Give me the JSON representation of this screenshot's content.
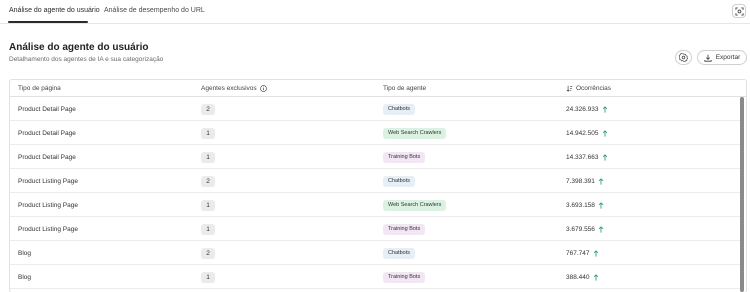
{
  "tabs": [
    {
      "label": "Análise do agente do usuário"
    },
    {
      "label": "Análise de desempenho do URL"
    }
  ],
  "header": {
    "title": "Análise do agente do usuário",
    "subtitle": "Detalhamento dos agentes de IA e sua categorização",
    "export_label": "Exportar"
  },
  "table": {
    "columns": [
      "Tipo de página",
      "Agentes exclusivos",
      "Tipo de agente",
      "Ocorrências"
    ],
    "rows": [
      {
        "page_type": "Product Detail Page",
        "agents": "2",
        "agent_type": "Chatbots",
        "occurrences": "24.326.933"
      },
      {
        "page_type": "Product Detail Page",
        "agents": "1",
        "agent_type": "Web Search Crawlers",
        "occurrences": "14.942.505"
      },
      {
        "page_type": "Product Detail Page",
        "agents": "1",
        "agent_type": "Training Bots",
        "occurrences": "14.337.663"
      },
      {
        "page_type": "Product Listing Page",
        "agents": "2",
        "agent_type": "Chatbots",
        "occurrences": "7.398.391"
      },
      {
        "page_type": "Product Listing Page",
        "agents": "1",
        "agent_type": "Web Search Crawlers",
        "occurrences": "3.693.158"
      },
      {
        "page_type": "Product Listing Page",
        "agents": "1",
        "agent_type": "Training Bots",
        "occurrences": "3.679.556"
      },
      {
        "page_type": "Blog",
        "agents": "2",
        "agent_type": "Chatbots",
        "occurrences": "767.747"
      },
      {
        "page_type": "Blog",
        "agents": "1",
        "agent_type": "Training Bots",
        "occurrences": "388.440"
      }
    ]
  },
  "colors": {
    "trend_up": "#2d9d78",
    "tag_chatbots": "#e6eef6",
    "tag_crawlers": "#dbf2e3",
    "tag_training": "#f2e6f4"
  },
  "icons": {
    "top_right": "focus-icon",
    "info": "info-icon",
    "sort": "sort-icon",
    "settings": "settings-icon",
    "export": "download-icon",
    "trend": "arrow-up-icon"
  }
}
